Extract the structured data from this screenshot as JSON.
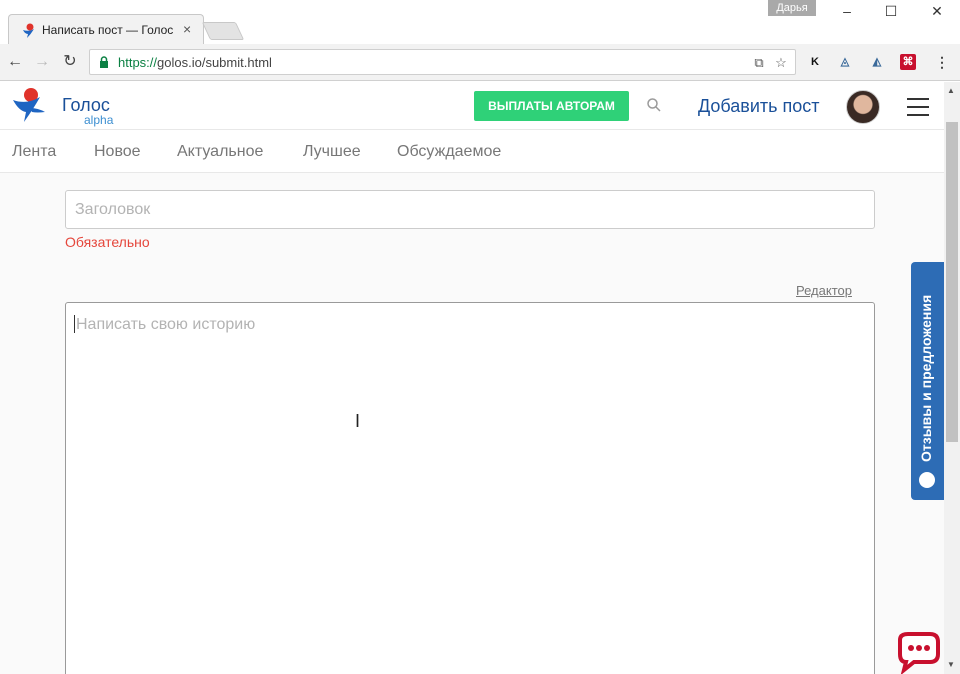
{
  "browser": {
    "tab_title": "Написать пост — Голос",
    "tab_close": "×",
    "profile_name": "Дарья",
    "url_scheme": "https://",
    "url_rest": "golos.io/submit.html",
    "ext_k": "K"
  },
  "header": {
    "brand": "Голос",
    "brand_sub": "alpha",
    "payout_button": "ВЫПЛАТЫ АВТОРАМ",
    "add_post": "Добавить пост"
  },
  "subnav": {
    "items": [
      "Лента",
      "Новое",
      "Актуальное",
      "Лучшее",
      "Обсуждаемое"
    ]
  },
  "form": {
    "title_placeholder": "Заголовок",
    "required_text": "Обязательно",
    "editor_link": "Редактор",
    "story_placeholder": "Написать свою историю"
  },
  "feedback": {
    "label": "Отзывы и предложения"
  },
  "colors": {
    "brand_blue": "#1a5099",
    "payout_green": "#2fd178",
    "error_red": "#e5463b",
    "feedback_blue": "#2d6cb5",
    "chat_red": "#c8102e"
  }
}
